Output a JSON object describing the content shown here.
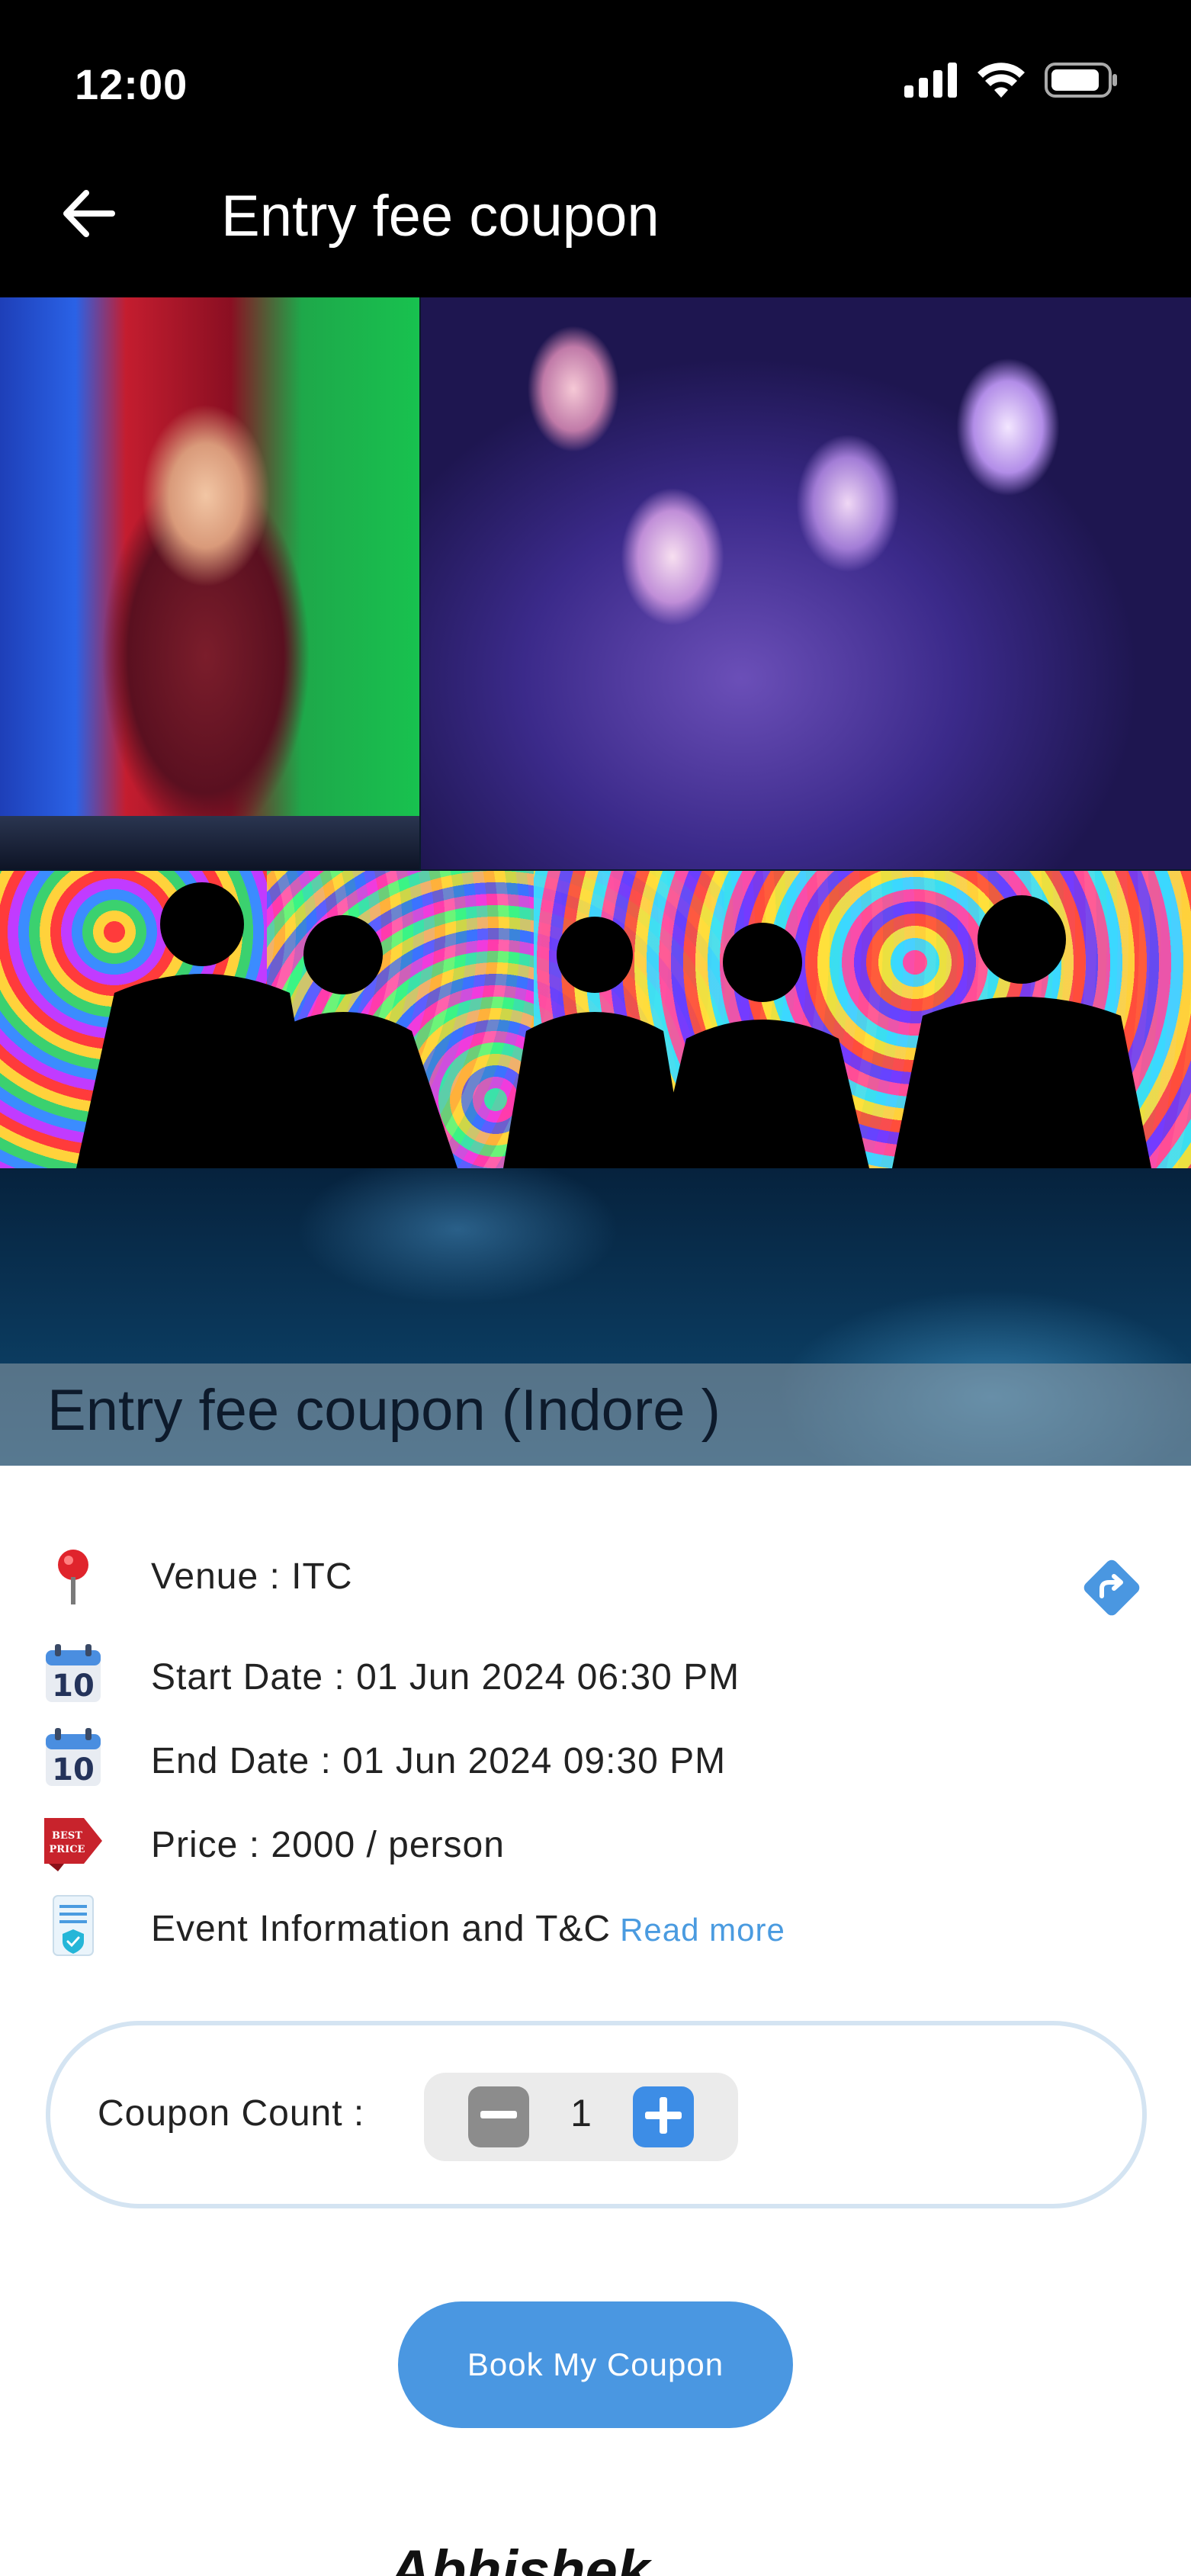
{
  "status_bar": {
    "time": "12:00",
    "icons": [
      "signal-icon",
      "wifi-icon",
      "battery-icon"
    ]
  },
  "app_bar": {
    "title": "Entry fee coupon",
    "back_icon": "arrow-left-icon"
  },
  "banner": {
    "caption": "Entry fee coupon (Indore )"
  },
  "details": {
    "venue": "Venue : ITC",
    "start_date": "Start Date : 01 Jun 2024  06:30 PM",
    "end_date": "End Date : 01 Jun 2024  09:30 PM",
    "price": "Price : 2000 / person",
    "info": "Event Information and T&C",
    "read_more": "Read more",
    "calendar_day": "10",
    "price_tag_text": "BEST PRICE"
  },
  "coupon": {
    "label": "Coupon Count :",
    "value": "1"
  },
  "actions": {
    "book_label": "Book My Coupon"
  },
  "footer": {
    "peek_text": "Abhishek"
  },
  "colors": {
    "accent": "#4a97e1",
    "plus": "#3d8de6",
    "minus": "#8c8c8c",
    "card_border": "#d4e4f2",
    "link": "#4a9be0"
  }
}
